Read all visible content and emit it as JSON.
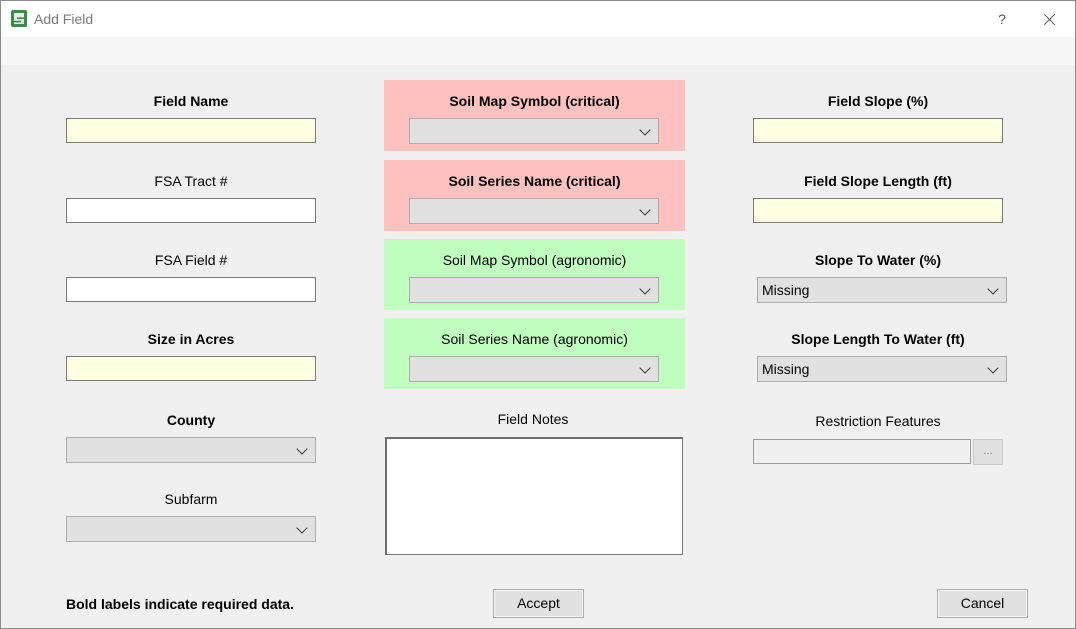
{
  "window": {
    "title": "Add Field",
    "help_label": "?"
  },
  "left": {
    "field_name_label": "Field Name",
    "fsa_tract_label": "FSA Tract #",
    "fsa_field_label": "FSA Field #",
    "size_acres_label": "Size in Acres",
    "county_label": "County",
    "subfarm_label": "Subfarm"
  },
  "middle": {
    "soil_map_symbol_critical_label": "Soil Map Symbol (critical)",
    "soil_series_name_critical_label": "Soil Series Name (critical)",
    "soil_map_symbol_agronomic_label": "Soil Map Symbol (agronomic)",
    "soil_series_name_agronomic_label": "Soil Series Name (agronomic)",
    "field_notes_label": "Field Notes"
  },
  "right": {
    "field_slope_label": "Field Slope (%)",
    "field_slope_length_label": "Field Slope Length (ft)",
    "slope_to_water_label": "Slope To Water (%)",
    "slope_to_water_value": "Missing",
    "slope_length_to_water_label": "Slope Length To Water (ft)",
    "slope_length_to_water_value": "Missing",
    "restriction_features_label": "Restriction Features",
    "browse_label": "..."
  },
  "footer": {
    "note": "Bold labels indicate required data.",
    "accept_label": "Accept",
    "cancel_label": "Cancel"
  },
  "colors": {
    "required_field": "#ffffe1",
    "critical_panel": "#ffc0c0",
    "agronomic_panel": "#c0ffc0"
  }
}
